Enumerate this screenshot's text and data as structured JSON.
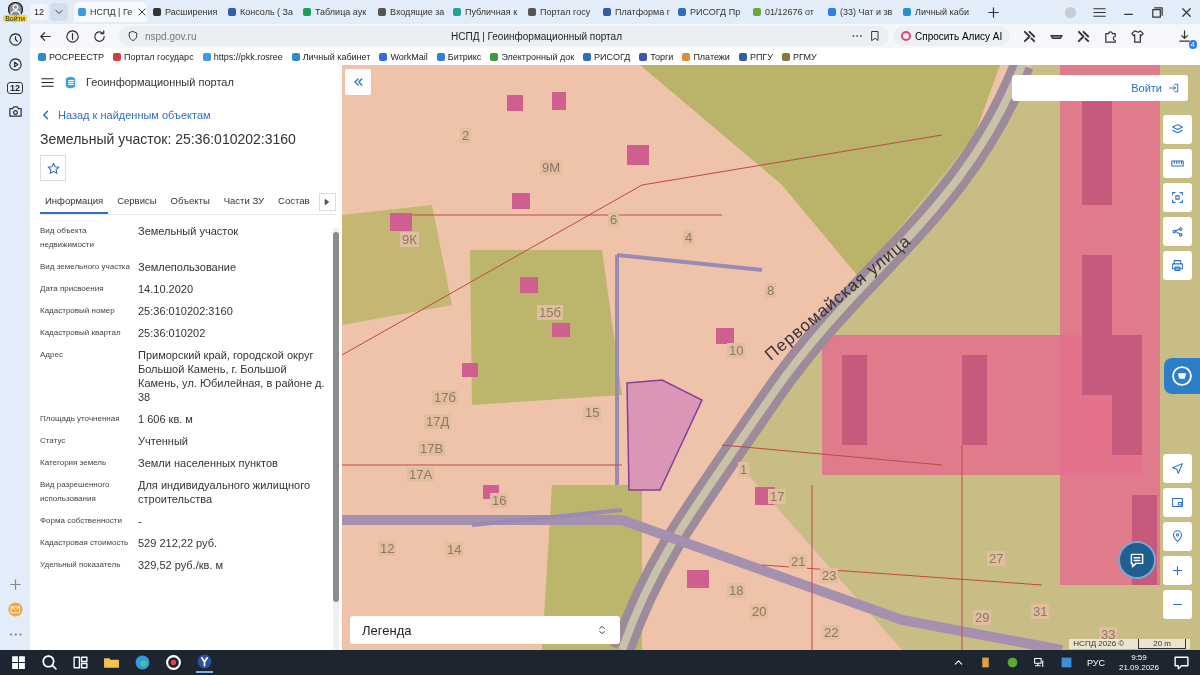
{
  "browser": {
    "profile_label": "Войти",
    "calendar_day": "12",
    "tab_count": "12",
    "tabs": [
      {
        "title": "НСПД | Ге",
        "selected": true,
        "color": "#3b9be0"
      },
      {
        "title": "Расширения",
        "selected": false,
        "color": "#333333"
      },
      {
        "title": "Консоль ( За",
        "selected": false,
        "color": "#2f5fa8"
      },
      {
        "title": "Таблица аук",
        "selected": false,
        "color": "#1e9e54"
      },
      {
        "title": "Входящие за",
        "selected": false,
        "color": "#555555"
      },
      {
        "title": "Публичная к",
        "selected": false,
        "color": "#2aa198"
      },
      {
        "title": "Портал госу",
        "selected": false,
        "color": "#555555"
      },
      {
        "title": "Платформа г",
        "selected": false,
        "color": "#3957a8"
      },
      {
        "title": "РИСОГД Пр",
        "selected": false,
        "color": "#2c6fb8"
      },
      {
        "title": "01/12676 от",
        "selected": false,
        "color": "#6aa83a"
      },
      {
        "title": "(33) Чат и зв",
        "selected": false,
        "color": "#2d7fe0"
      },
      {
        "title": "Личный каби",
        "selected": false,
        "color": "#2a8fc9"
      }
    ],
    "url": "nspd.gov.ru",
    "page_title": "НСПД | Геоинформационный портал",
    "alice_button": "Спросить Алису AI",
    "downloads_count": "4",
    "bookmarks": [
      {
        "title": "РОСРЕЕСТР",
        "color": "#2a8fc9"
      },
      {
        "title": "Портал государс",
        "color": "#d33a3a"
      },
      {
        "title": "https://pkk.rosree",
        "color": "#3b9be0"
      },
      {
        "title": "Личный кабинет",
        "color": "#2a8fc9"
      },
      {
        "title": "WorkMail",
        "color": "#2d6fe0"
      },
      {
        "title": "Битрикс",
        "color": "#2d7fe0"
      },
      {
        "title": "Электронный док",
        "color": "#3a9a3a"
      },
      {
        "title": "РИСОГД",
        "color": "#2c6fb8"
      },
      {
        "title": "Торги",
        "color": "#3957a8"
      },
      {
        "title": "Платежи",
        "color": "#e08a3a"
      },
      {
        "title": "РПГУ",
        "color": "#2f5fa8"
      },
      {
        "title": "РГМУ",
        "color": "#8a7a3a"
      }
    ]
  },
  "panel": {
    "app_title": "Геоинформационный портал",
    "back_link": "Назад к найденным объектам",
    "heading": "Земельный участок: 25:36:010202:3160",
    "favorite": false,
    "tabs": [
      {
        "label": "Информация",
        "selected": true
      },
      {
        "label": "Сервисы",
        "selected": false
      },
      {
        "label": "Объекты",
        "selected": false
      },
      {
        "label": "Части ЗУ",
        "selected": false
      },
      {
        "label": "Состав",
        "selected": false
      }
    ],
    "properties": [
      {
        "label": "Вид объекта недвижимости",
        "value": "Земельный участок"
      },
      {
        "label": "Вид земельного участка",
        "value": "Землепользование"
      },
      {
        "label": "Дата присвоения",
        "value": "14.10.2020"
      },
      {
        "label": "Кадастровый номер",
        "value": "25:36:010202:3160"
      },
      {
        "label": "Кадастровый квартал",
        "value": "25:36:010202"
      },
      {
        "label": "Адрес",
        "value": "Приморский край, городской округ Большой Камень, г. Большой Камень, ул. Юбилейная, в районе д. 38"
      },
      {
        "label": "Площадь уточненная",
        "value": "1 606 кв. м"
      },
      {
        "label": "Статус",
        "value": "Учтенный"
      },
      {
        "label": "Категория земель",
        "value": "Земли населенных пунктов"
      },
      {
        "label": "Вид разрешенного использования",
        "value": "Для индивидуального жилищного строительства"
      },
      {
        "label": "Форма собственности",
        "value": "-"
      },
      {
        "label": "Кадастровая стоимость",
        "value": "529 212,22 руб."
      },
      {
        "label": "Удельный показатель",
        "value": "329,52 руб./кв. м"
      }
    ]
  },
  "map": {
    "login_button": "Войти",
    "legend": "Легенда",
    "attribution": "НСПД 2026 ©",
    "scale": "20 m",
    "street_name": "Первомайская улица",
    "house_numbers": [
      "2",
      "9М",
      "9К",
      "6",
      "4",
      "8",
      "15б",
      "10",
      "17б",
      "17Д",
      "17В",
      "17А",
      "15",
      "1",
      "17",
      "16",
      "12",
      "14",
      "21",
      "23",
      "27",
      "18",
      "20",
      "22",
      "29",
      "31",
      "33"
    ]
  },
  "taskbar": {
    "language": "РУС",
    "time": "9:59",
    "date": "21.09.2026"
  }
}
